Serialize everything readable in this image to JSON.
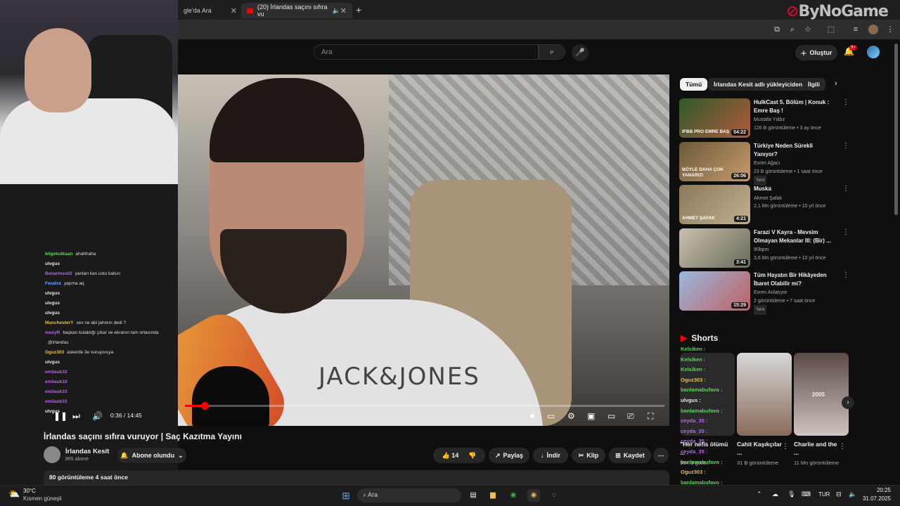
{
  "browser": {
    "tabs": [
      {
        "label": "gle'da Ara"
      },
      {
        "label": "(20) İrlandas saçını sıfıra vu"
      }
    ],
    "new_tab": "+",
    "brand": "ByNoGame"
  },
  "header": {
    "search_placeholder": "Ara",
    "create_label": "Oluştur",
    "notifications_badge": "9+"
  },
  "player": {
    "time": "0:36 / 14:45",
    "progress_fraction": 0.041,
    "shirt_text": "JACK&JONES"
  },
  "video": {
    "title": "İrlandas saçını sıfıra vuruyor | Saç Kazıtma Yayını",
    "channel": "İrlandas Kesit",
    "subscribers": "865 abone",
    "subscribe_label": "Abone olundu",
    "likes": "14",
    "share_label": "Paylaş",
    "download_label": "İndir",
    "clip_label": "Klip",
    "save_label": "Kaydet",
    "views_date": "80 görüntüleme  4 saat önce"
  },
  "stream_chat": [
    {
      "user": "bilgekulkaan",
      "msg": "ahahhaha",
      "color": "#5fd35f"
    },
    {
      "user": "ulvgus",
      "msg": "",
      "color": "#e8e8e8"
    },
    {
      "user": "Benarmes02",
      "msg": "yanları kes ustu kalsın",
      "color": "#b06bd6"
    },
    {
      "user": "Feratxx",
      "msg": "yapma aq",
      "color": "#6fa8ff"
    },
    {
      "user": "ulvgus",
      "msg": "",
      "color": "#e8e8e8"
    },
    {
      "user": "ulvgus",
      "msg": "",
      "color": "#e8e8e8"
    },
    {
      "user": "ulvgus",
      "msg": "",
      "color": "#e8e8e8"
    },
    {
      "user": "ManchesterY",
      "msg": "sex ne abi jahreın dedi ?",
      "color": "#e0c24a"
    },
    {
      "user": "maxyR",
      "msg": "başkan kulaklığı çıkar ve ekranın tam ortasında",
      "color": "#b06bd6"
    },
    {
      "user": "",
      "msg": "@irlandas",
      "color": "#e8e8e8"
    },
    {
      "user": "Oguz303",
      "msg": "askerde 3e vuruyoruya",
      "color": "#e0c24a"
    },
    {
      "user": "ulvgus",
      "msg": "",
      "color": "#e8e8e8"
    },
    {
      "user": "emilauk33",
      "msg": "",
      "color": "#b06bd6"
    },
    {
      "user": "emilauk33",
      "msg": "",
      "color": "#b06bd6"
    },
    {
      "user": "emilauk33",
      "msg": "",
      "color": "#b06bd6"
    },
    {
      "user": "emilauk33",
      "msg": "",
      "color": "#b06bd6"
    },
    {
      "user": "ulvgus",
      "msg": "",
      "color": "#e8e8e8"
    }
  ],
  "sidebar": {
    "chips": [
      "Tümü",
      "İrlandas Kesit adlı yükleyiciden",
      "İlgili"
    ],
    "recs": [
      {
        "title": "HulkCast 5. Bölüm | Konuk : Emre Baş !",
        "channel": "Mustafa Yıldız",
        "meta": "126 B görüntüleme • 3 ay önce",
        "duration": "54:22",
        "thumb_text": "IFBB PRO EMRE BAŞ",
        "new": ""
      },
      {
        "title": "Türkiye Neden Sürekli Yanıyor?",
        "channel": "Evrim Ağacı",
        "meta": "23 B görüntüleme • 1 saat önce",
        "duration": "26:06",
        "thumb_text": "BÖYLE DAHA ÇOK YANARIZ!",
        "new": "Yeni"
      },
      {
        "title": "Muska",
        "channel": "Ahmet Şafak",
        "meta": "2,1 Mn görüntüleme • 10 yıl önce",
        "duration": "4:21",
        "thumb_text": "AHMET ŞAFAK",
        "new": ""
      },
      {
        "title": "Farazi V Kayra - Mevsim Olmayan Mekanlar III: (Bir) ...",
        "channel": "90bpm",
        "meta": "3,6 Mn görüntüleme • 10 yıl önce",
        "duration": "3:41",
        "thumb_text": "",
        "new": ""
      },
      {
        "title": "Tüm Hayatın Bir Hikâyeden İbaret Olabilir mi?",
        "channel": "Evren Anlatıyor",
        "meta": "2 görüntüleme • 7 saat önce",
        "duration": "15:29",
        "thumb_text": "",
        "new": "Yeni"
      }
    ],
    "shorts_title": "Shorts",
    "shorts_chat": [
      {
        "user": "Kelsiken :",
        "color": "#5fd35f"
      },
      {
        "user": "Kelsiken :",
        "color": "#5fd35f"
      },
      {
        "user": "Kelsiken :",
        "color": "#5fd35f"
      },
      {
        "user": "Oguz303 :",
        "color": "#e0c24a"
      },
      {
        "user": "banlamabufavo :",
        "color": "#5fd35f"
      },
      {
        "user": "ulvgus :",
        "color": "#e8e8e8"
      },
      {
        "user": "banlamabufavo :",
        "color": "#5fd35f"
      },
      {
        "user": "ceyda_35 :",
        "color": "#b06bd6"
      },
      {
        "user": "ceyda_35 :",
        "color": "#b06bd6"
      },
      {
        "user": "ceyda_35 :",
        "color": "#b06bd6"
      },
      {
        "user": "ceyda_35 :",
        "color": "#b06bd6"
      },
      {
        "user": "banlamabufavo :",
        "color": "#5fd35f"
      },
      {
        "user": "Oguz303 :",
        "color": "#e0c24a"
      },
      {
        "user": "banlamabufavo :",
        "color": "#5fd35f"
      }
    ],
    "shorts": [
      {
        "title": "\"Her nefis ölümü ...",
        "views": "954 B görü..."
      },
      {
        "title": "Cahit Kaşıkçılar ...",
        "views": "31 B görüntüleme"
      },
      {
        "title": "Charlie and the ...",
        "views": "11 Mn görüntüleme",
        "overlay": "2005"
      }
    ]
  },
  "taskbar": {
    "weather_temp": "30°C",
    "weather_desc": "Kısmen güneşli",
    "search_label": "Ara",
    "lang": "TUR",
    "time": "20:25",
    "date": "31.07.2025"
  }
}
